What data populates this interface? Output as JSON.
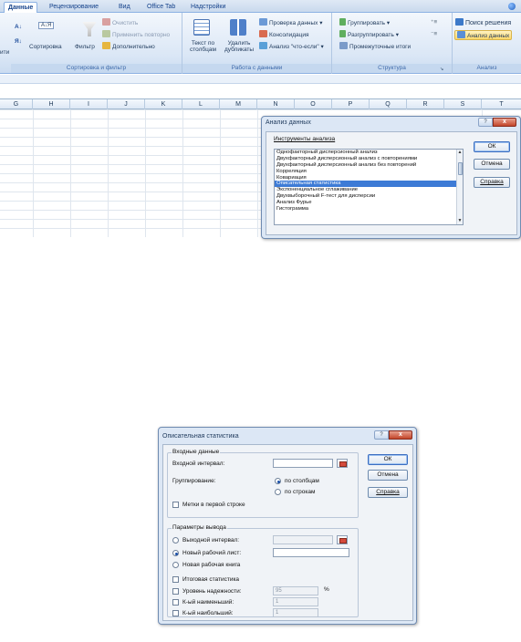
{
  "ribbon": {
    "tabs": [
      "Данные",
      "Рецензирование",
      "Вид",
      "Office Tab",
      "Надстройки"
    ],
    "active_tab": "Данные",
    "sort_group": {
      "sort_az": "А↓Я",
      "sort_button": "Сортировка",
      "filter_button": "Фильтр",
      "clear": "Очистить",
      "reapply": "Применить повторно",
      "advanced": "Дополнительно",
      "label": "Сортировка и фильтр"
    },
    "data_tools": {
      "text_to_columns": "Текст по столбцам",
      "text_to_columns_l1": "Текст по",
      "text_to_columns_l2": "столбцам",
      "remove_duplicates_l1": "Удалить",
      "remove_duplicates_l2": "дубликаты",
      "validation": "Проверка данных",
      "consolidate": "Консолидация",
      "what_if": "Анализ \"что-если\"",
      "label": "Работа с данными"
    },
    "outline": {
      "group": "Группировать",
      "ungroup": "Разгруппировать",
      "subtotal": "Промежуточные итоги",
      "label": "Структура"
    },
    "analysis": {
      "solver": "Поиск решения",
      "data_analysis": "Анализ данных",
      "label": "Анализ"
    },
    "left_cut": "ити"
  },
  "sheet": {
    "columns": [
      "G",
      "H",
      "I",
      "J",
      "K",
      "L",
      "M",
      "N",
      "O",
      "P",
      "Q",
      "R",
      "S",
      "T"
    ]
  },
  "dialog1": {
    "title": "Анализ данных",
    "help_glyph": "?",
    "close_glyph": "x",
    "tools_label": "Инструменты анализа",
    "items": [
      "Однофакторный дисперсионный анализ",
      "Двухфакторный дисперсионный анализ с повторениями",
      "Двухфакторный дисперсионный анализ без повторений",
      "Корреляция",
      "Ковариация",
      "Описательная статистика",
      "Экспоненциальное сглаживание",
      "Двухвыборочный F-тест для дисперсии",
      "Анализ Фурье",
      "Гистограмма"
    ],
    "selected_index": 5,
    "ok": "ОК",
    "cancel": "Отмена",
    "help": "Справка"
  },
  "dialog2": {
    "title": "Описательная статистика",
    "help_glyph": "?",
    "close_glyph": "x",
    "input_section": "Входные данные",
    "input_range_label": "Входной интервал:",
    "grouping_label": "Группирование:",
    "by_columns": "по столбцам",
    "by_rows": "по строкам",
    "labels_first_row": "Метки в первой строке",
    "output_section": "Параметры вывода",
    "output_range": "Выходной интервал:",
    "new_sheet": "Новый рабочий лист:",
    "new_workbook": "Новая рабочая книга",
    "summary_stats": "Итоговая статистика",
    "confidence_level": "Уровень надежности:",
    "confidence_value": "95",
    "percent": "%",
    "kth_smallest": "К-ый наименьший:",
    "kth_smallest_value": "1",
    "kth_largest": "К-ый наибольший:",
    "kth_largest_value": "1",
    "ok": "ОК",
    "cancel": "Отмена",
    "help": "Справка"
  }
}
